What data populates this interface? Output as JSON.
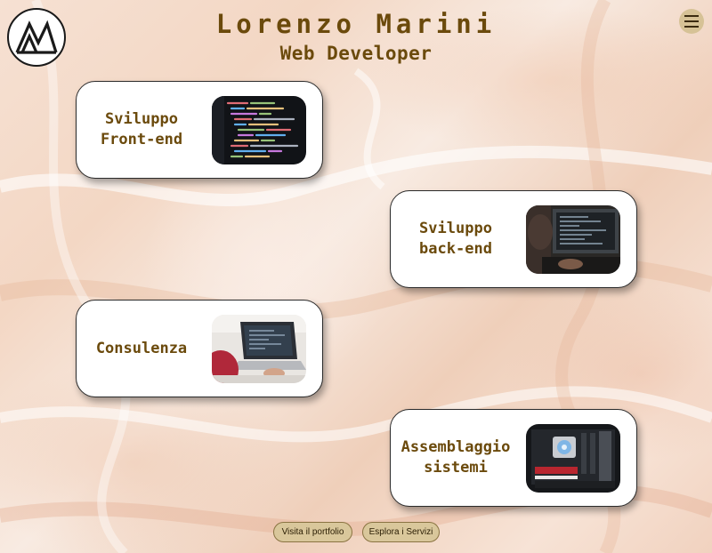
{
  "header": {
    "name": "Lorenzo Marini",
    "role": "Web Developer"
  },
  "logo": {
    "icon": "lm-monogram-logo",
    "letters": "LM"
  },
  "menu": {
    "icon": "hamburger-menu-icon",
    "color": "#d6c296"
  },
  "services": [
    {
      "label": "Sviluppo\nFront-end",
      "image": "code-screen-image"
    },
    {
      "label": "Sviluppo\nback-end",
      "image": "developer-monitor-image"
    },
    {
      "label": "Consulenza",
      "image": "laptop-consulting-image"
    },
    {
      "label": "Assemblaggio\nsistemi",
      "image": "pc-hardware-image"
    }
  ],
  "actions": {
    "portfolio": "Visita il portfolio",
    "services": "Esplora i Servizi"
  },
  "colors": {
    "accent_text": "#6b4a0c",
    "button_bg": "#d9c79b"
  }
}
